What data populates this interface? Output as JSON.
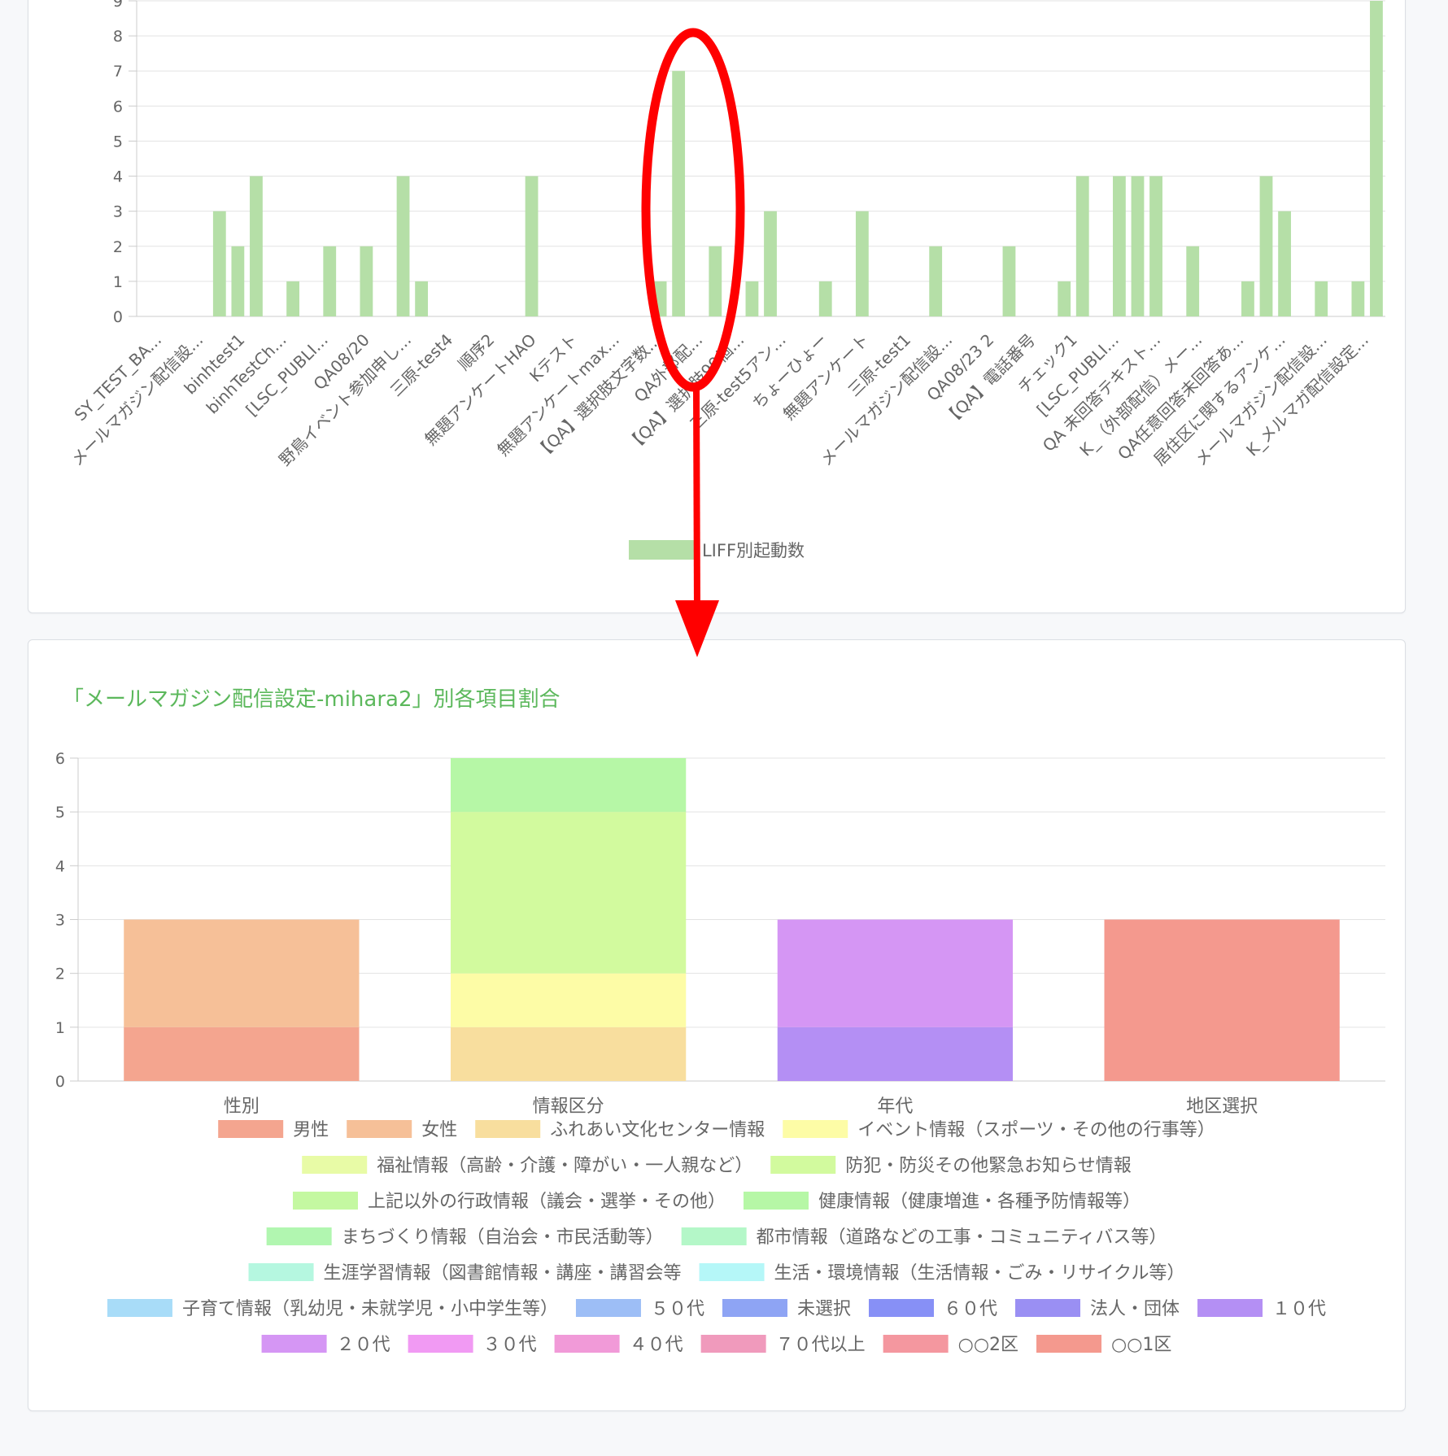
{
  "chart_data": [
    {
      "type": "bar",
      "ylim": [
        0,
        9
      ],
      "y_ticks": [
        0,
        1,
        2,
        3,
        4,
        5,
        6,
        7,
        8,
        9
      ],
      "grid": true,
      "legend_placement": "bottom",
      "color": "#b5dfa7",
      "x_labels": [
        "SY_TEST_BA...",
        "メールマガジン配信設...",
        "binhtest1",
        "binhTestCh...",
        "[LSC_PUBLI...",
        "QA08/20",
        "野鳥イベント参加申し...",
        "三原-test4",
        "順序2",
        "無題アンケートHAO",
        "Kテスト",
        "無題アンケートmax...",
        "【QA】選択肢文字数...",
        "QA外部配...",
        "【QA】選択肢99個...",
        "三原-test5アン...",
        "ちょーひょー",
        "無題アンケート",
        "三原-test1",
        "メールマガジン配信設...",
        "QA08/23 2",
        "【QA】電話番号",
        "チェック1",
        "[LSC_PUBLI...",
        "QA 未回答テキスト...",
        "K_（外部配信）メー...",
        "QA任意回答未回答あ...",
        "居住区に関するアンケ...",
        "メールマガジン配信設...",
        "K_メルマガ配信設定..."
      ],
      "bar_values": [
        0,
        0,
        0,
        0,
        3,
        2,
        4,
        0,
        1,
        0,
        2,
        0,
        2,
        0,
        4,
        1,
        0,
        0,
        0,
        0,
        0,
        4,
        0,
        0,
        0,
        0,
        0,
        0,
        1,
        7,
        0,
        2,
        0,
        1,
        3,
        0,
        0,
        1,
        0,
        3,
        0,
        0,
        0,
        2,
        0,
        0,
        0,
        2,
        0,
        0,
        1,
        4,
        0,
        4,
        4,
        4,
        0,
        2,
        0,
        0,
        1,
        4,
        3,
        0,
        1,
        0,
        1,
        9
      ],
      "series": [
        {
          "name": "LIFF別起動数"
        }
      ],
      "annotation": "red ellipse around the bar of 7 with a red arrow pointing down to the chart below"
    },
    {
      "type": "bar",
      "stacked": true,
      "title": "「メールマガジン配信設定-mihara2」別各項目割合",
      "ylim": [
        0,
        6
      ],
      "y_ticks": [
        0,
        1,
        2,
        3,
        4,
        5,
        6
      ],
      "grid": true,
      "legend_placement": "bottom",
      "categories": [
        "性別",
        "情報区分",
        "年代",
        "地区選択"
      ],
      "series": [
        {
          "name": "男性",
          "color": "#f4a58f",
          "values": [
            1,
            0,
            0,
            0
          ]
        },
        {
          "name": "女性",
          "color": "#f6c098",
          "values": [
            2,
            0,
            0,
            0
          ]
        },
        {
          "name": "ふれあい文化センター情報",
          "color": "#f8de9e",
          "values": [
            0,
            1,
            0,
            0
          ]
        },
        {
          "name": "イベント情報（スポーツ・その他の行事等）",
          "color": "#fdfca6",
          "values": [
            0,
            1,
            0,
            0
          ]
        },
        {
          "name": "福祉情報（高齢・介護・障がい・一人親など）",
          "color": "#e8fba6",
          "values": [
            0,
            0,
            0,
            0
          ]
        },
        {
          "name": "防犯・防災その他緊急お知らせ情報",
          "color": "#d2fa9e",
          "values": [
            0,
            3,
            0,
            0
          ]
        },
        {
          "name": "上記以外の行政情報（議会・選挙・その他）",
          "color": "#c4f8a1",
          "values": [
            0,
            0,
            0,
            0
          ]
        },
        {
          "name": "健康情報（健康増進・各種予防情報等）",
          "color": "#b6f7a6",
          "values": [
            0,
            1,
            0,
            0
          ]
        },
        {
          "name": "まちづくり情報（自治会・市民活動等）",
          "color": "#b1f6b0",
          "values": [
            0,
            0,
            0,
            0
          ]
        },
        {
          "name": "都市情報（道路などの工事・コミュニティバス等）",
          "color": "#b4f7c8",
          "values": [
            0,
            0,
            0,
            0
          ]
        },
        {
          "name": "生涯学習情報（図書館情報・講座・講習会等",
          "color": "#b5f7e0",
          "values": [
            0,
            0,
            0,
            0
          ]
        },
        {
          "name": "生活・環境情報（生活情報・ごみ・リサイクル等）",
          "color": "#b5f7f8",
          "values": [
            0,
            0,
            0,
            0
          ]
        },
        {
          "name": "子育て情報（乳幼児・未就学児・小中学生等）",
          "color": "#a8dcf8",
          "values": [
            0,
            0,
            0,
            0
          ]
        },
        {
          "name": "５０代",
          "color": "#9dbef6",
          "values": [
            0,
            0,
            0,
            0
          ]
        },
        {
          "name": "未選択",
          "color": "#8ea4f4",
          "values": [
            0,
            0,
            0,
            0
          ]
        },
        {
          "name": "６０代",
          "color": "#8790f6",
          "values": [
            0,
            0,
            0,
            0
          ]
        },
        {
          "name": "法人・団体",
          "color": "#9a8ff3",
          "values": [
            0,
            0,
            0,
            0
          ]
        },
        {
          "name": "１０代",
          "color": "#b48ff4",
          "values": [
            0,
            0,
            1,
            0
          ]
        },
        {
          "name": "２０代",
          "color": "#d596f4",
          "values": [
            0,
            0,
            2,
            0
          ]
        },
        {
          "name": "３０代",
          "color": "#f19af3",
          "values": [
            0,
            0,
            0,
            0
          ]
        },
        {
          "name": "４０代",
          "color": "#f19ad8",
          "values": [
            0,
            0,
            0,
            0
          ]
        },
        {
          "name": "７０代以上",
          "color": "#f09abc",
          "values": [
            0,
            0,
            0,
            0
          ]
        },
        {
          "name": "○○2区",
          "color": "#f4979f",
          "values": [
            0,
            0,
            0,
            0
          ]
        },
        {
          "name": "○○1区",
          "color": "#f4998e",
          "values": [
            0,
            0,
            0,
            3
          ]
        }
      ]
    }
  ]
}
